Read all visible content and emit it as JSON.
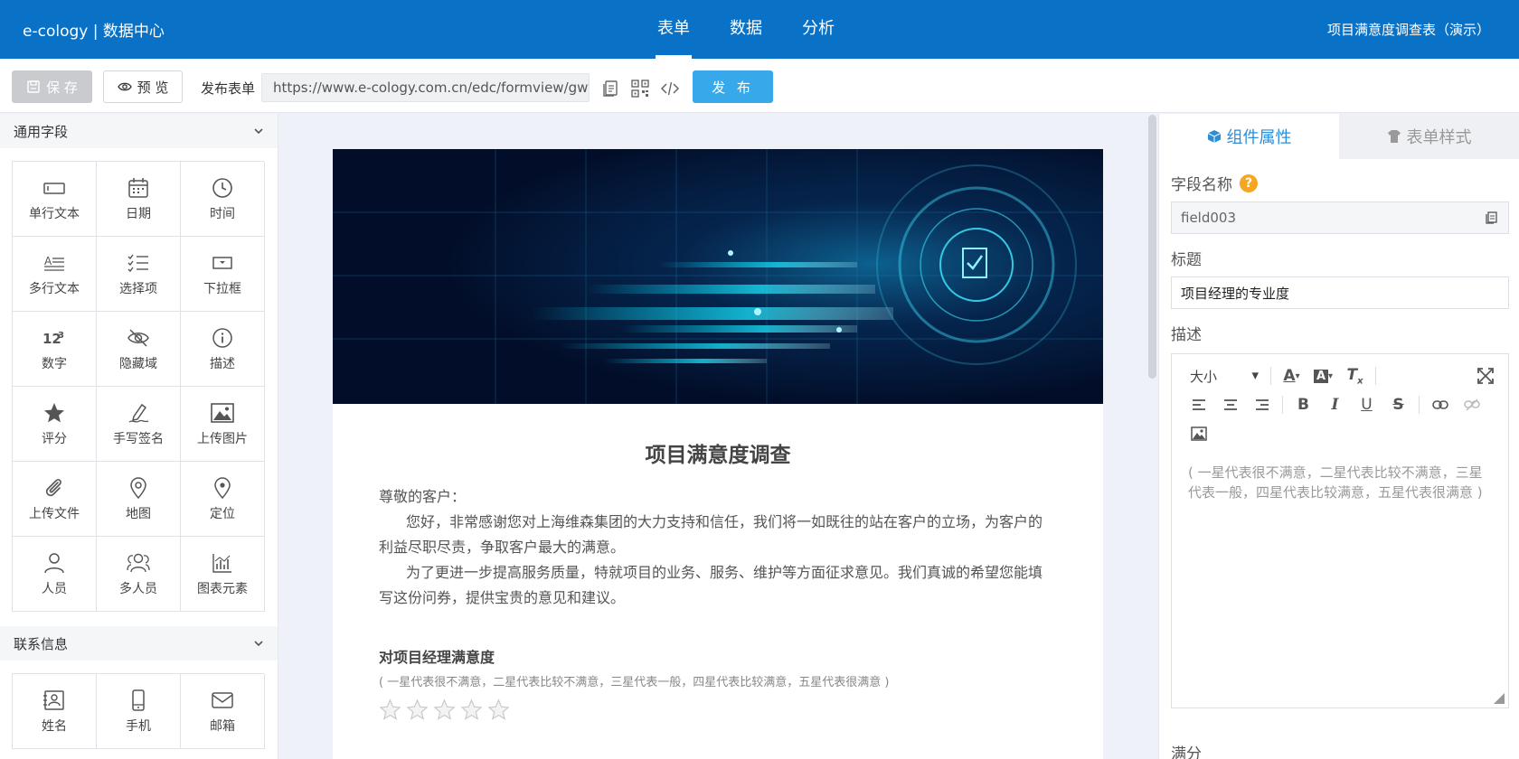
{
  "topbar": {
    "brand": "e-cology | 数据中心",
    "nav": [
      "表单",
      "数据",
      "分析"
    ],
    "doc_title": "项目满意度调查表（演示）"
  },
  "toolbar": {
    "save_label": "保 存",
    "preview_label": "预 览",
    "publish_label_text": "发布表单",
    "url": "https://www.e-cology.com.cn/edc/formview/gwthkj",
    "publish_label": "发 布"
  },
  "left": {
    "section1": "通用字段",
    "general_fields": [
      {
        "label": "单行文本",
        "icon": "single-line-text-icon"
      },
      {
        "label": "日期",
        "icon": "calendar-icon"
      },
      {
        "label": "时间",
        "icon": "clock-icon"
      },
      {
        "label": "多行文本",
        "icon": "multi-line-text-icon"
      },
      {
        "label": "选择项",
        "icon": "checklist-icon"
      },
      {
        "label": "下拉框",
        "icon": "dropdown-icon"
      },
      {
        "label": "数字",
        "icon": "number-icon"
      },
      {
        "label": "隐藏域",
        "icon": "eye-off-icon"
      },
      {
        "label": "描述",
        "icon": "info-icon"
      },
      {
        "label": "评分",
        "icon": "star-icon"
      },
      {
        "label": "手写签名",
        "icon": "signature-icon"
      },
      {
        "label": "上传图片",
        "icon": "image-icon"
      },
      {
        "label": "上传文件",
        "icon": "paperclip-icon"
      },
      {
        "label": "地图",
        "icon": "map-pin-icon"
      },
      {
        "label": "定位",
        "icon": "location-icon"
      },
      {
        "label": "人员",
        "icon": "user-icon"
      },
      {
        "label": "多人员",
        "icon": "users-icon"
      },
      {
        "label": "图表元素",
        "icon": "chart-icon"
      }
    ],
    "section2": "联系信息",
    "contact_fields": [
      {
        "label": "姓名",
        "icon": "contact-card-icon"
      },
      {
        "label": "手机",
        "icon": "mobile-icon"
      },
      {
        "label": "邮箱",
        "icon": "mail-icon"
      }
    ]
  },
  "form": {
    "title": "项目满意度调查",
    "greeting": "尊敬的客户：",
    "para1": "您好，非常感谢您对上海维森集团的大力支持和信任，我们将一如既往的站在客户的立场，为客户的利益尽职尽责，争取客户最大的满意。",
    "para2": "为了更进一步提高服务质量，特就项目的业务、服务、维护等方面征求意见。我们真诚的希望您能填写这份问券，提供宝贵的意见和建议。",
    "question": {
      "title": "对项目经理满意度",
      "desc": "( 一星代表很不满意，二星代表比较不满意，三星代表一般，四星代表比较满意，五星代表很满意 )",
      "rating": 0,
      "max": 5
    }
  },
  "right": {
    "tab_props": "组件属性",
    "tab_style": "表单样式",
    "field_name_label": "字段名称",
    "field_name_value": "field003",
    "title_label": "标题",
    "title_value": "项目经理的专业度",
    "desc_label": "描述",
    "size_label": "大小",
    "desc_value": "( 一星代表很不满意，二星代表比较不满意，三星代表一般，四星代表比较满意，五星代表很满意 )",
    "score_label": "满分"
  },
  "colors": {
    "brand_blue": "#0a72c6",
    "publish_blue": "#37a9ea",
    "help_orange": "#f5a623",
    "tab_active": "#2d8ed8"
  }
}
